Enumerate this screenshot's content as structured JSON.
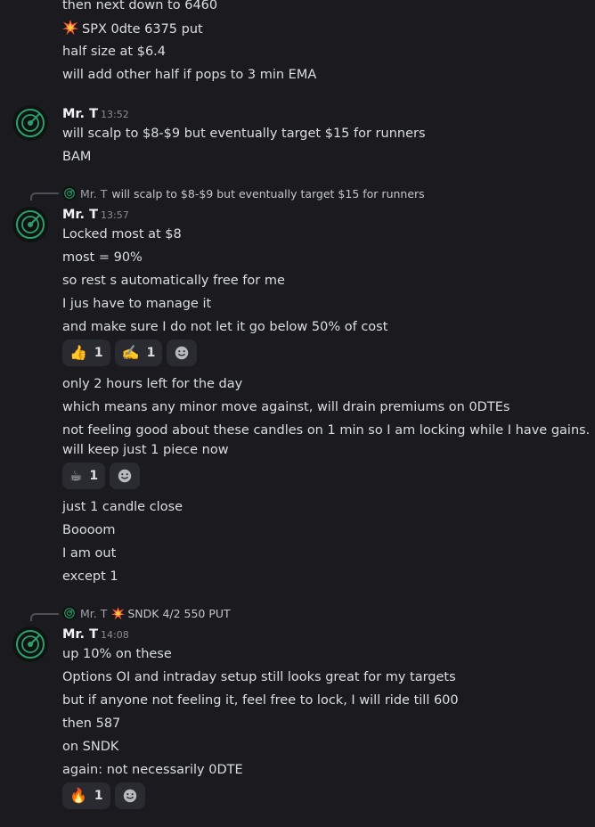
{
  "messages": {
    "block0": {
      "lines": [
        "then next down to 6460",
        "SPX 0dte 6375 put",
        "half size at $6.4",
        "will add other half if pops to 3 min EMA"
      ]
    },
    "block1": {
      "author": "Mr. T",
      "time": "13:52",
      "lines": [
        "will scalp to $8-$9 but eventually target $15 for runners",
        "BAM"
      ]
    },
    "block2": {
      "reply_author": "Mr. T",
      "reply_text": "will scalp to $8-$9 but eventually target $15 for runners",
      "author": "Mr. T",
      "time": "13:57",
      "lines": [
        "Locked most at $8",
        "most = 90%",
        "so rest s automatically free for me",
        "I jus have to manage it",
        "and make sure I do not let it go below 50% of cost"
      ],
      "reactions": [
        {
          "emoji": "👍",
          "count": "1"
        },
        {
          "emoji": "✍️",
          "count": "1"
        }
      ],
      "lines2": [
        "only 2 hours left for the day",
        "which means  any minor move against, will drain premiums on 0DTEs",
        "not feeling good about these candles on 1 min so I am locking while I have gains.",
        "will keep just 1 piece now"
      ],
      "reactions2": [
        {
          "emoji": "☕",
          "count": "1"
        }
      ],
      "lines3": [
        "just 1 candle close",
        "Boooom",
        "I am out",
        "except 1"
      ]
    },
    "block3": {
      "reply_author": "Mr. T",
      "reply_text": "SNDK 4/2 550 PUT",
      "author": "Mr. T",
      "time": "14:08",
      "lines": [
        "up 10% on these",
        "Options OI and intraday setup still looks great for my targets",
        "but if anyone not feeling it, feel free to lock, I will ride till 600",
        "then 587",
        "on SNDK",
        "again: not necessarily 0DTE"
      ],
      "reactions": [
        {
          "emoji": "🔥",
          "count": "1"
        }
      ]
    }
  },
  "icons": {
    "avatar": "radar-avatar-icon",
    "boom": "collision-emoji-icon",
    "add_reaction": "smiley-add-reaction-icon"
  },
  "colors": {
    "background": "#1b1b1f",
    "text": "#dbdee1",
    "timestamp": "#8b8d93",
    "chip": "#2a2b30",
    "avatar_ring": "#2f9e6c"
  }
}
